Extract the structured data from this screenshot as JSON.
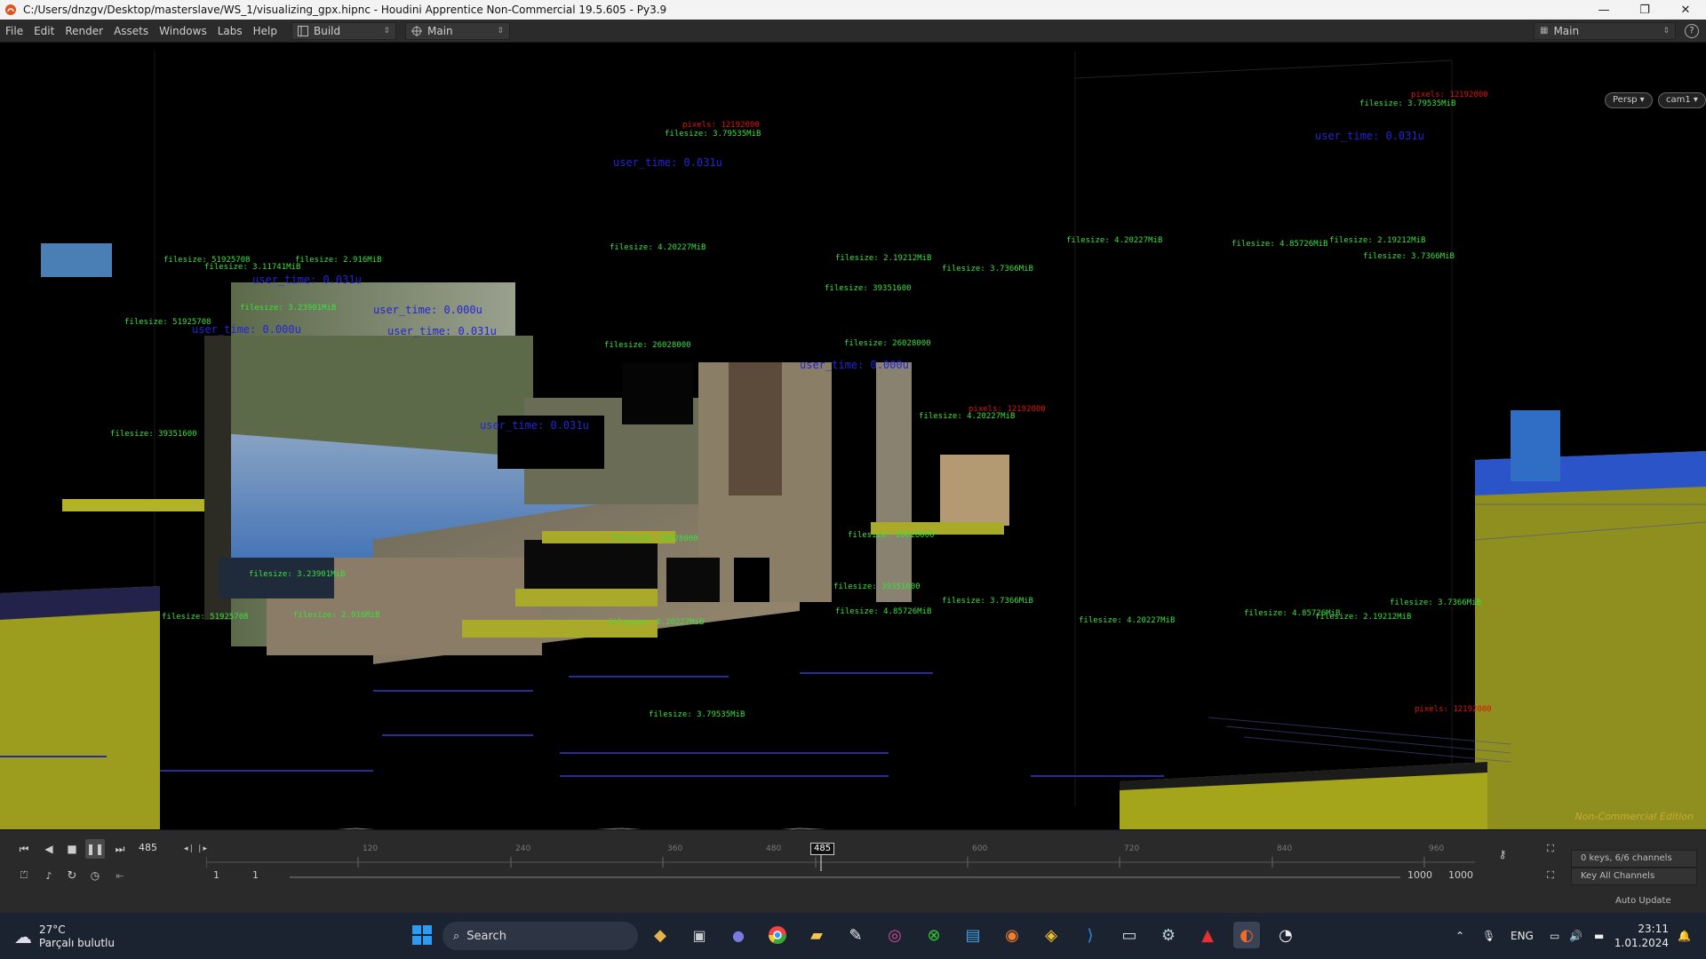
{
  "window": {
    "title": "C:/Users/dnzgv/Desktop/masterslave/WS_1/visualizing_gpx.hipnc - Houdini Apprentice Non-Commercial 19.5.605 - Py3.9",
    "minimize": "—",
    "maximize": "❐",
    "close": "✕"
  },
  "menu": {
    "items": [
      "File",
      "Edit",
      "Render",
      "Assets",
      "Windows",
      "Labs",
      "Help"
    ],
    "desktop_label": "Build",
    "network_label": "Main",
    "right_desktop_label": "Main",
    "help": "?"
  },
  "viewport": {
    "camera_menu": "Persp ▾",
    "cam_menu": "cam1 ▾",
    "watermark": "Non-Commercial Edition",
    "colors": {
      "red": "#e01010",
      "green": "#39e13b",
      "blue": "#2424d8",
      "olive": "#b4b41a"
    },
    "overlays": [
      {
        "text": "pixels: 12192000",
        "color": "red"
      },
      {
        "text": "filesize: 3.79535MiB",
        "color": "green"
      },
      {
        "text": "user_time: 0.031u",
        "color": "blue"
      },
      {
        "text": "filesize: 4.20227MiB",
        "color": "green"
      },
      {
        "text": "filesize: 2.19212MiB",
        "color": "green"
      },
      {
        "text": "filesize: 3.7366MiB",
        "color": "green"
      },
      {
        "text": "filesize: 4.85726MiB",
        "color": "green"
      },
      {
        "text": "filesize: 2.916MiB",
        "color": "green"
      },
      {
        "text": "filesize: 3.11741MiB",
        "color": "green"
      },
      {
        "text": "filesize: 39351600",
        "color": "green"
      },
      {
        "text": "filesize: 26028000",
        "color": "green"
      },
      {
        "text": "filesize: 3.23901MiB",
        "color": "green"
      },
      {
        "text": "filesize: 51925708",
        "color": "green"
      },
      {
        "text": "user_time: 0.000u",
        "color": "blue"
      }
    ]
  },
  "timeline": {
    "current_frame": "485",
    "cursor_label": "485",
    "ruler_ticks": [
      "120",
      "240",
      "360",
      "480",
      "600",
      "720",
      "840",
      "960"
    ],
    "keys_info": "0 keys, 6/6 channels",
    "start_frame": "1",
    "start_frame2": "1",
    "end_frame": "1000",
    "end_frame2": "1000",
    "key_all": "Key All Channels",
    "auto_update": "Auto Update"
  },
  "taskbar": {
    "temperature": "27°C",
    "weather_desc": "Parçalı bulutlu",
    "search_placeholder": "Search",
    "lang": "ENG",
    "time": "23:11",
    "date": "1.01.2024"
  }
}
